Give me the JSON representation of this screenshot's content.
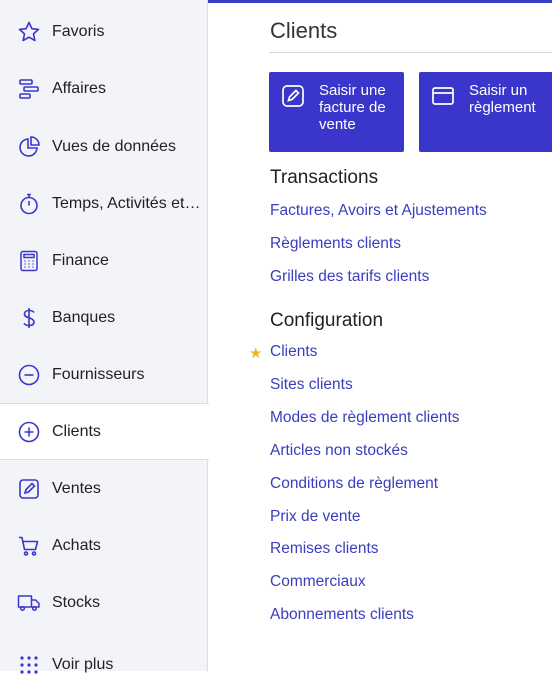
{
  "sidebar": {
    "items": [
      {
        "label": "Favoris",
        "icon": "star-icon"
      },
      {
        "label": "Affaires",
        "icon": "timeline-icon"
      },
      {
        "label": "Vues de données",
        "icon": "pie-chart-icon"
      },
      {
        "label": "Temps, Activités et Notes de frais",
        "icon": "stopwatch-icon"
      },
      {
        "label": "Finance",
        "icon": "calculator-icon"
      },
      {
        "label": "Banques",
        "icon": "dollar-icon"
      },
      {
        "label": "Fournisseurs",
        "icon": "minus-circle-icon"
      },
      {
        "label": "Clients",
        "icon": "plus-circle-icon",
        "active": true
      },
      {
        "label": "Ventes",
        "icon": "pencil-square-icon"
      },
      {
        "label": "Achats",
        "icon": "cart-icon"
      },
      {
        "label": "Stocks",
        "icon": "truck-icon"
      },
      {
        "label": "Voir plus",
        "icon": "grid-dots-icon"
      }
    ]
  },
  "main": {
    "title": "Clients",
    "actions": [
      {
        "label": "Saisir une facture de vente",
        "icon": "pencil-square-icon"
      },
      {
        "label": "Saisir un règlement",
        "icon": "card-icon"
      }
    ],
    "transactions": {
      "title": "Transactions",
      "links": [
        "Factures, Avoirs et Ajustements",
        "Règlements clients",
        "Grilles des tarifs clients"
      ]
    },
    "configuration": {
      "title": "Configuration",
      "links": [
        "Clients",
        "Sites clients",
        "Modes de règlement clients",
        "Articles non stockés",
        "Conditions de règlement",
        "Prix de vente",
        "Remises clients",
        "Commerciaux",
        "Abonnements clients"
      ],
      "favorite_marker": "★"
    }
  },
  "colors": {
    "accent": "#3a36cc",
    "link": "#3a3dbe",
    "star": "#f1b51c",
    "sidebar_bg": "#f3f4f7"
  }
}
